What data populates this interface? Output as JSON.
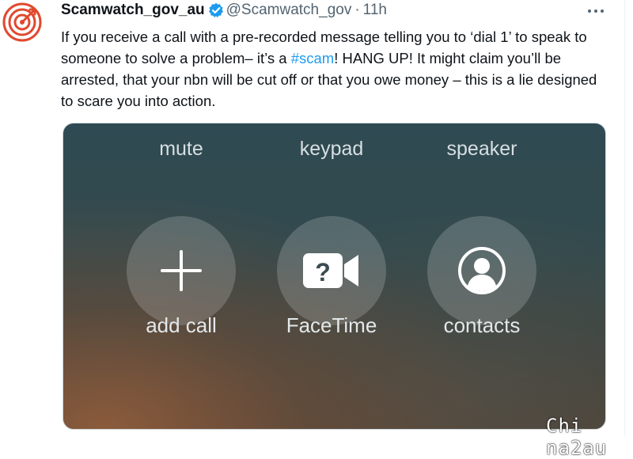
{
  "tweet": {
    "display_name": "Scamwatch_gov_au",
    "handle": "@Scamwatch_gov",
    "separator": "·",
    "time": "11h",
    "text_part1": "If you receive a call with a pre-recorded message telling you to ‘dial 1’ to speak to someone to solve a problem– it’s a ",
    "hashtag": "#scam",
    "text_part2": "! HANG UP! It might claim you’ll be arrested, that your nbn will be cut off or that you owe money – this is a lie designed to scare you into action.",
    "icons": {
      "avatar": "target-logo-icon",
      "verified": "verified-badge-icon",
      "more": "more-options-icon"
    }
  },
  "call_screen": {
    "top_labels": [
      "mute",
      "keypad",
      "speaker"
    ],
    "buttons": [
      {
        "label": "add call",
        "icon": "plus-icon"
      },
      {
        "label": "FaceTime",
        "icon": "facetime-question-icon"
      },
      {
        "label": "contacts",
        "icon": "contact-person-icon"
      }
    ]
  },
  "watermark": "Chi na2au",
  "colors": {
    "brand": "#e0492f",
    "link": "#1d9bf0",
    "verified": "#1d9bf0",
    "secondary_text": "#536471"
  }
}
